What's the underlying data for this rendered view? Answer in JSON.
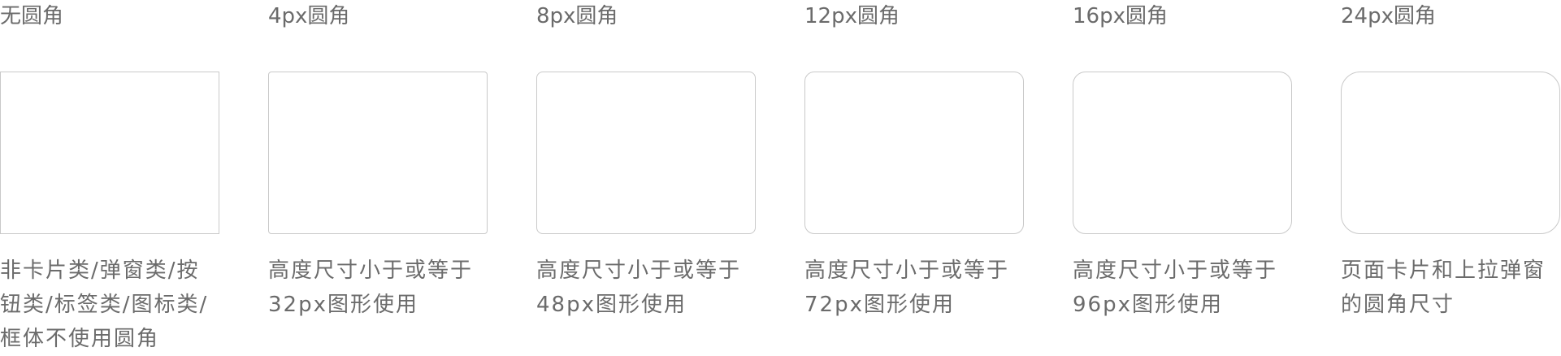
{
  "radius_specs": [
    {
      "title": "无圆角",
      "radius": "0px",
      "desc_lines": [
        "非卡片类/弹窗类/按",
        "钮类/标签类/图标类/",
        "框体不使用圆角"
      ]
    },
    {
      "title": "4px圆角",
      "radius": "4px",
      "desc_lines": [
        "高度尺寸小于或等于",
        "32px图形使用"
      ]
    },
    {
      "title": "8px圆角",
      "radius": "8px",
      "desc_lines": [
        "高度尺寸小于或等于",
        "48px图形使用"
      ]
    },
    {
      "title": "12px圆角",
      "radius": "12px",
      "desc_lines": [
        "高度尺寸小于或等于",
        "72px图形使用"
      ]
    },
    {
      "title": "16px圆角",
      "radius": "16px",
      "desc_lines": [
        "高度尺寸小于或等于",
        "96px图形使用"
      ]
    },
    {
      "title": "24px圆角",
      "radius": "24px",
      "desc_lines": [
        "页面卡片和上拉弹窗",
        "的圆角尺寸"
      ]
    }
  ]
}
